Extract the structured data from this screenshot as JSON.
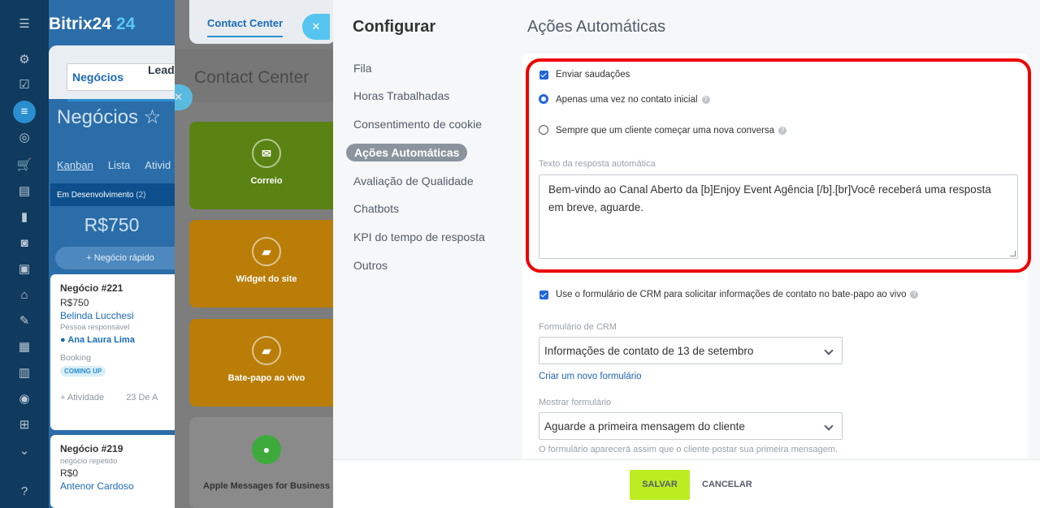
{
  "crm": {
    "logo": "Bitrix24",
    "logo_num": "24",
    "tabs": [
      "Negócios",
      "Leads"
    ],
    "page_title": "Negócios",
    "views": [
      "Kanban",
      "Lista",
      "Ativid"
    ],
    "stage": {
      "name": "Em Desenvolvimento",
      "count": "(2)"
    },
    "stage_sum": "R$750",
    "quick_deal": "+ Negócio rápido",
    "cards": [
      {
        "title": "Negócio #221",
        "amount": "R$750",
        "client": "Belinda Lucchesi",
        "resp_label": "Pessoa responsável",
        "responsible": "Ana Laura Lima",
        "field": "Booking",
        "badge": "COMING UP",
        "activity": "+ Atividade",
        "date": "23 De A"
      },
      {
        "title": "Negócio #219",
        "subtitle": "negócio repetido",
        "amount": "R$0",
        "client": "Antenor Cardoso"
      }
    ]
  },
  "contact_center": {
    "tab": "Contact Center",
    "title": "Contact Center",
    "tiles": [
      "Correio",
      "Widget do site",
      "Bate-papo ao vivo",
      "Apple Messages for Business"
    ]
  },
  "panel": {
    "side_title": "Configurar",
    "menu": [
      "Fila",
      "Horas Trabalhadas",
      "Consentimento de cookie",
      "Ações Automáticas",
      "Avaliação de Qualidade",
      "Chatbots",
      "KPI do tempo de resposta",
      "Outros"
    ],
    "content_title": "Ações Automáticas",
    "send_greetings": "Enviar saudações",
    "radio_once": "Apenas uma vez no contato inicial",
    "radio_always": "Sempre que um cliente começar uma nova conversa",
    "auto_text_label": "Texto da resposta automática",
    "auto_text": "Bem-vindo ao Canal Aberto da [b]Enjoy Event Agência [/b].[br]Você receberá uma resposta em breve, aguarde.",
    "crm_form_check": "Use o formulário de CRM para solicitar informações de contato no bate-papo ao vivo",
    "crm_form_label": "Formulário de CRM",
    "crm_form_value": "Informações de contato de 13 de setembro",
    "create_form_link": "Criar um novo formulário",
    "show_form_label": "Mostrar formulário",
    "show_form_value": "Aguarde a primeira mensagem do cliente",
    "show_form_hint": "O formulário aparecerá assim que o cliente postar sua primeira mensagem.",
    "save": "SALVAR",
    "cancel": "CANCELAR"
  },
  "colors": {
    "accent": "#2066d9",
    "save_button": "#bbed21",
    "highlight": "#ef0000"
  }
}
